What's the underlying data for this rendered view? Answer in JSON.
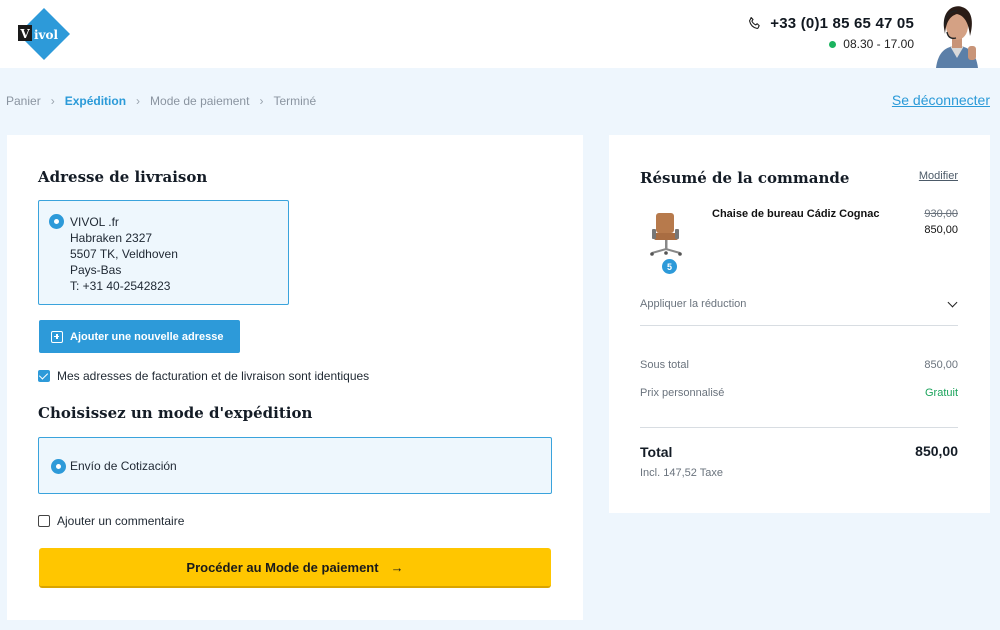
{
  "header": {
    "logo_text": "vivol",
    "phone": "+33 (0)1 85 65 47 05",
    "hours": "08.30 - 17.00",
    "status_color": "#1bb35f"
  },
  "breadcrumb": {
    "items": [
      "Panier",
      "Expédition",
      "Mode de paiement",
      "Terminé"
    ],
    "active": "Expédition",
    "logout": "Se déconnecter"
  },
  "delivery": {
    "title": "Adresse de livraison",
    "address_lines": [
      "VIVOL .fr",
      "Habraken 2327",
      "5507 TK, Veldhoven",
      "Pays-Bas",
      "T: +31 40-2542823"
    ],
    "add_address_label": "Ajouter une nouvelle adresse",
    "same_address_label": "Mes adresses de facturation et de livraison sont identiques",
    "same_address_checked": true
  },
  "shipping": {
    "title": "Choisissez un mode d'expédition",
    "option": "Envío de Cotización",
    "comment_label": "Ajouter un commentaire",
    "comment_checked": false,
    "proceed_label": "Procéder au Mode de paiement",
    "proceed_arrow": "→"
  },
  "summary": {
    "title": "Résumé de la commande",
    "modify": "Modifier",
    "product": {
      "name": "Chaise de bureau Cádiz Cognac",
      "old_price": "930,00",
      "price": "850,00",
      "quantity": "5"
    },
    "discount_label": "Appliquer la réduction",
    "subtotal_label": "Sous total",
    "subtotal_value": "850,00",
    "custom_price_label": "Prix personnalisé",
    "custom_price_value": "Gratuit",
    "total_label": "Total",
    "total_value": "850,00",
    "tax_line": "Incl. 147,52 Taxe"
  },
  "colors": {
    "accent_blue": "#2d9ad9",
    "cta_yellow": "#ffc600",
    "free_green": "#1ba35c"
  }
}
